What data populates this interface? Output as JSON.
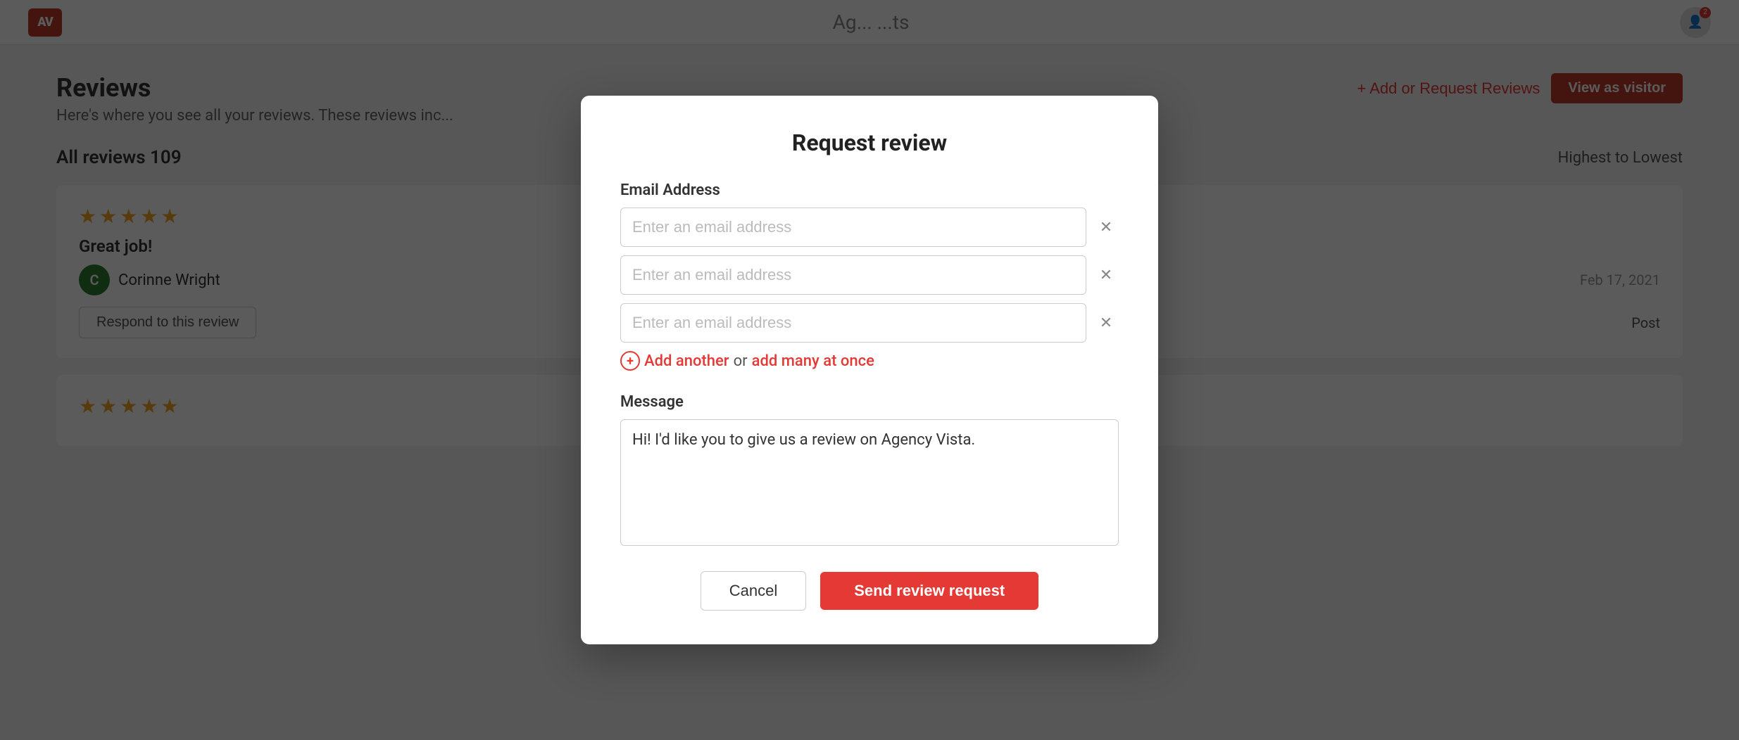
{
  "navbar": {
    "logo_text": "AV",
    "center_text": "Ag... ...ts",
    "badge_count": "2"
  },
  "page": {
    "title": "Reviews",
    "subtitle": "Here's where you see all your reviews. These reviews inc...",
    "reviews_count_label": "All reviews 109",
    "sort_label": "Highest to Lowest"
  },
  "actions": {
    "add_reviews_label": "+ Add or Request Reviews",
    "view_visitor_label": "View as visitor"
  },
  "reviews": [
    {
      "stars": 5,
      "text": "Great job!",
      "reviewer_initial": "C",
      "reviewer_name": "Corinne Wright",
      "date": "Feb 17, 2021",
      "respond_label": "Respond to this review",
      "post_label": "Post"
    },
    {
      "stars": 5,
      "text": "",
      "reviewer_initial": "",
      "reviewer_name": "",
      "date": "",
      "respond_label": "",
      "post_label": ""
    }
  ],
  "modal": {
    "title": "Request review",
    "email_section_label": "Email Address",
    "email_placeholders": [
      "Enter an email address",
      "Enter an email address",
      "Enter an email address"
    ],
    "add_another_label": "Add another",
    "separator_label": "or",
    "add_many_label": "add many at once",
    "message_section_label": "Message",
    "message_value": "Hi! I'd like you to give us a review on Agency Vista.",
    "cancel_label": "Cancel",
    "send_label": "Send review request"
  }
}
